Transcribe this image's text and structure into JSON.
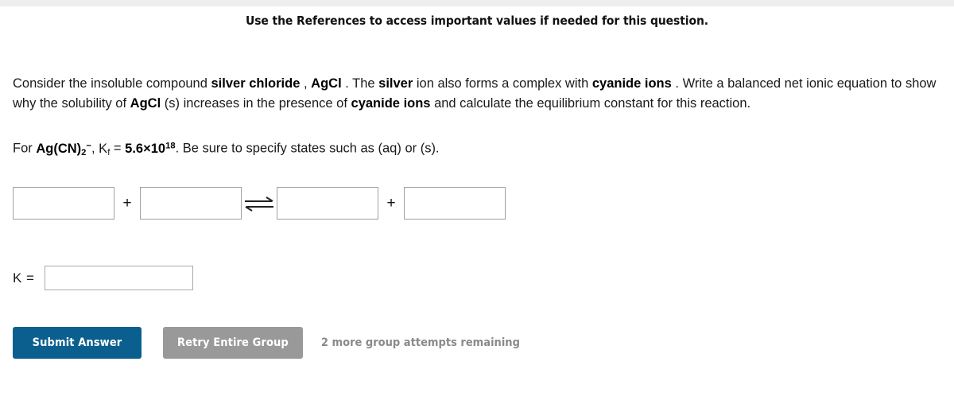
{
  "header": {
    "references_notice": "Use the References to access important values if needed for this question."
  },
  "question": {
    "segment_1": "Consider the insoluble compound ",
    "bold_1": "silver chloride",
    "segment_2": " , ",
    "bold_2": "AgCl",
    "segment_3": " . The ",
    "bold_3": "silver",
    "segment_4": " ion also forms a complex with ",
    "bold_4": "cyanide ions",
    "segment_5": " . Write a balanced net ionic equation to show why the solubility of ",
    "bold_5": "AgCl",
    "segment_6": " (s) increases in the presence of ",
    "bold_6": "cyanide ions",
    "segment_7": " and calculate the equilibrium constant for this reaction."
  },
  "kf_line": {
    "for_label": "For",
    "complex_formula": "Ag(CN)",
    "complex_subscript": "2",
    "complex_superscript": "−",
    "comma": ",",
    "k_symbol": "K",
    "k_subscript": "f",
    "equals": "=",
    "kf_value": "5.6×10",
    "kf_exponent": "18",
    "instruction": ". Be sure to specify states such as (aq) or (s)."
  },
  "equation": {
    "boxes": [
      {
        "name": "reactant-1",
        "value": "",
        "placeholder": ""
      },
      {
        "name": "reactant-2",
        "value": "",
        "placeholder": ""
      },
      {
        "name": "product-1",
        "value": "",
        "placeholder": ""
      },
      {
        "name": "product-2",
        "value": "",
        "placeholder": ""
      }
    ],
    "plus_operator": "+",
    "equilibrium_arrow": "⇌"
  },
  "k_answer": {
    "label": "K =",
    "value": "",
    "placeholder": ""
  },
  "actions": {
    "submit_label": "Submit Answer",
    "retry_label": "Retry Entire Group",
    "attempts_remaining": "2 more group attempts remaining"
  },
  "colors": {
    "submit_blue": "#0b5f8f",
    "retry_gray": "#999999",
    "attempts_text_gray": "#8a8a8a",
    "top_strip": "#eeeeee",
    "input_border": "#a0a0a0"
  }
}
